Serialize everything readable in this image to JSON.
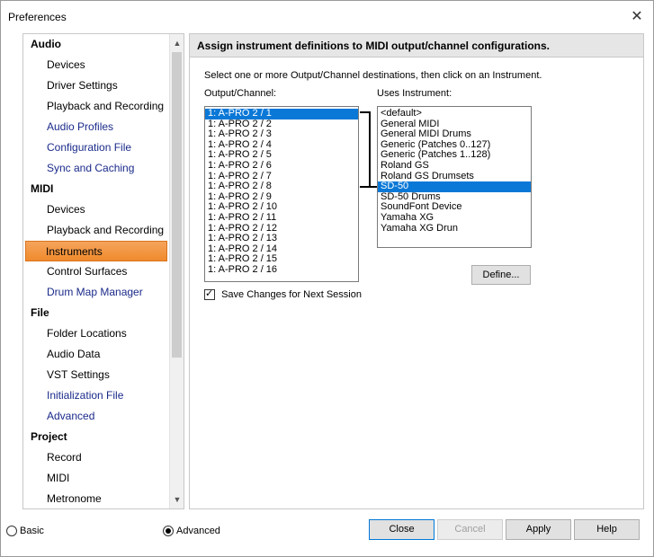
{
  "window": {
    "title": "Preferences",
    "close_glyph": "✕"
  },
  "sidebar": {
    "groups": [
      {
        "label": "Audio",
        "items": [
          {
            "label": "Devices",
            "blue": false
          },
          {
            "label": "Driver Settings",
            "blue": false
          },
          {
            "label": "Playback and Recording",
            "blue": false
          },
          {
            "label": "Audio Profiles",
            "blue": true
          },
          {
            "label": "Configuration File",
            "blue": true
          },
          {
            "label": "Sync and Caching",
            "blue": true
          }
        ]
      },
      {
        "label": "MIDI",
        "items": [
          {
            "label": "Devices",
            "blue": false
          },
          {
            "label": "Playback and Recording",
            "blue": false
          },
          {
            "label": "Instruments",
            "blue": false,
            "selected": true
          },
          {
            "label": "Control Surfaces",
            "blue": false
          },
          {
            "label": "Drum Map Manager",
            "blue": true
          }
        ]
      },
      {
        "label": "File",
        "items": [
          {
            "label": "Folder Locations",
            "blue": false
          },
          {
            "label": "Audio Data",
            "blue": false
          },
          {
            "label": "VST Settings",
            "blue": false
          },
          {
            "label": "Initialization File",
            "blue": true
          },
          {
            "label": "Advanced",
            "blue": true
          }
        ]
      },
      {
        "label": "Project",
        "items": [
          {
            "label": "Record",
            "blue": false
          },
          {
            "label": "MIDI",
            "blue": false
          },
          {
            "label": "Metronome",
            "blue": false
          }
        ]
      }
    ],
    "scroll_up_glyph": "▲",
    "scroll_down_glyph": "▼"
  },
  "panel": {
    "header": "Assign instrument definitions to MIDI output/channel configurations.",
    "instructions": "Select one or more Output/Channel destinations, then click on an Instrument.",
    "output_label": "Output/Channel:",
    "instrument_label": "Uses Instrument:",
    "outputs": [
      "1: A-PRO 2 / 1",
      "1: A-PRO 2 / 2",
      "1: A-PRO 2 / 3",
      "1: A-PRO 2 / 4",
      "1: A-PRO 2 / 5",
      "1: A-PRO 2 / 6",
      "1: A-PRO 2 / 7",
      "1: A-PRO 2 / 8",
      "1: A-PRO 2 / 9",
      "1: A-PRO 2 / 10",
      "1: A-PRO 2 / 11",
      "1: A-PRO 2 / 12",
      "1: A-PRO 2 / 13",
      "1: A-PRO 2 / 14",
      "1: A-PRO 2 / 15",
      "1: A-PRO 2 / 16"
    ],
    "selected_output_index": 0,
    "instruments": [
      "<default>",
      "General MIDI",
      "General MIDI Drums",
      "Generic (Patches 0..127)",
      "Generic (Patches 1..128)",
      "Roland GS",
      "Roland GS Drumsets",
      "SD-50",
      "SD-50 Drums",
      "SoundFont Device",
      "Yamaha XG",
      "Yamaha XG Drun"
    ],
    "selected_instrument_index": 7,
    "define_label": "Define...",
    "save_changes_label": "Save Changes for Next Session",
    "save_changes_checked": true
  },
  "bottom": {
    "basic_label": "Basic",
    "advanced_label": "Advanced",
    "mode": "advanced",
    "close_label": "Close",
    "cancel_label": "Cancel",
    "apply_label": "Apply",
    "help_label": "Help"
  },
  "colors": {
    "selection_blue": "#0a78d7",
    "sidebar_selected_orange": "#f08a2c",
    "link_blue": "#1a2a8a"
  }
}
